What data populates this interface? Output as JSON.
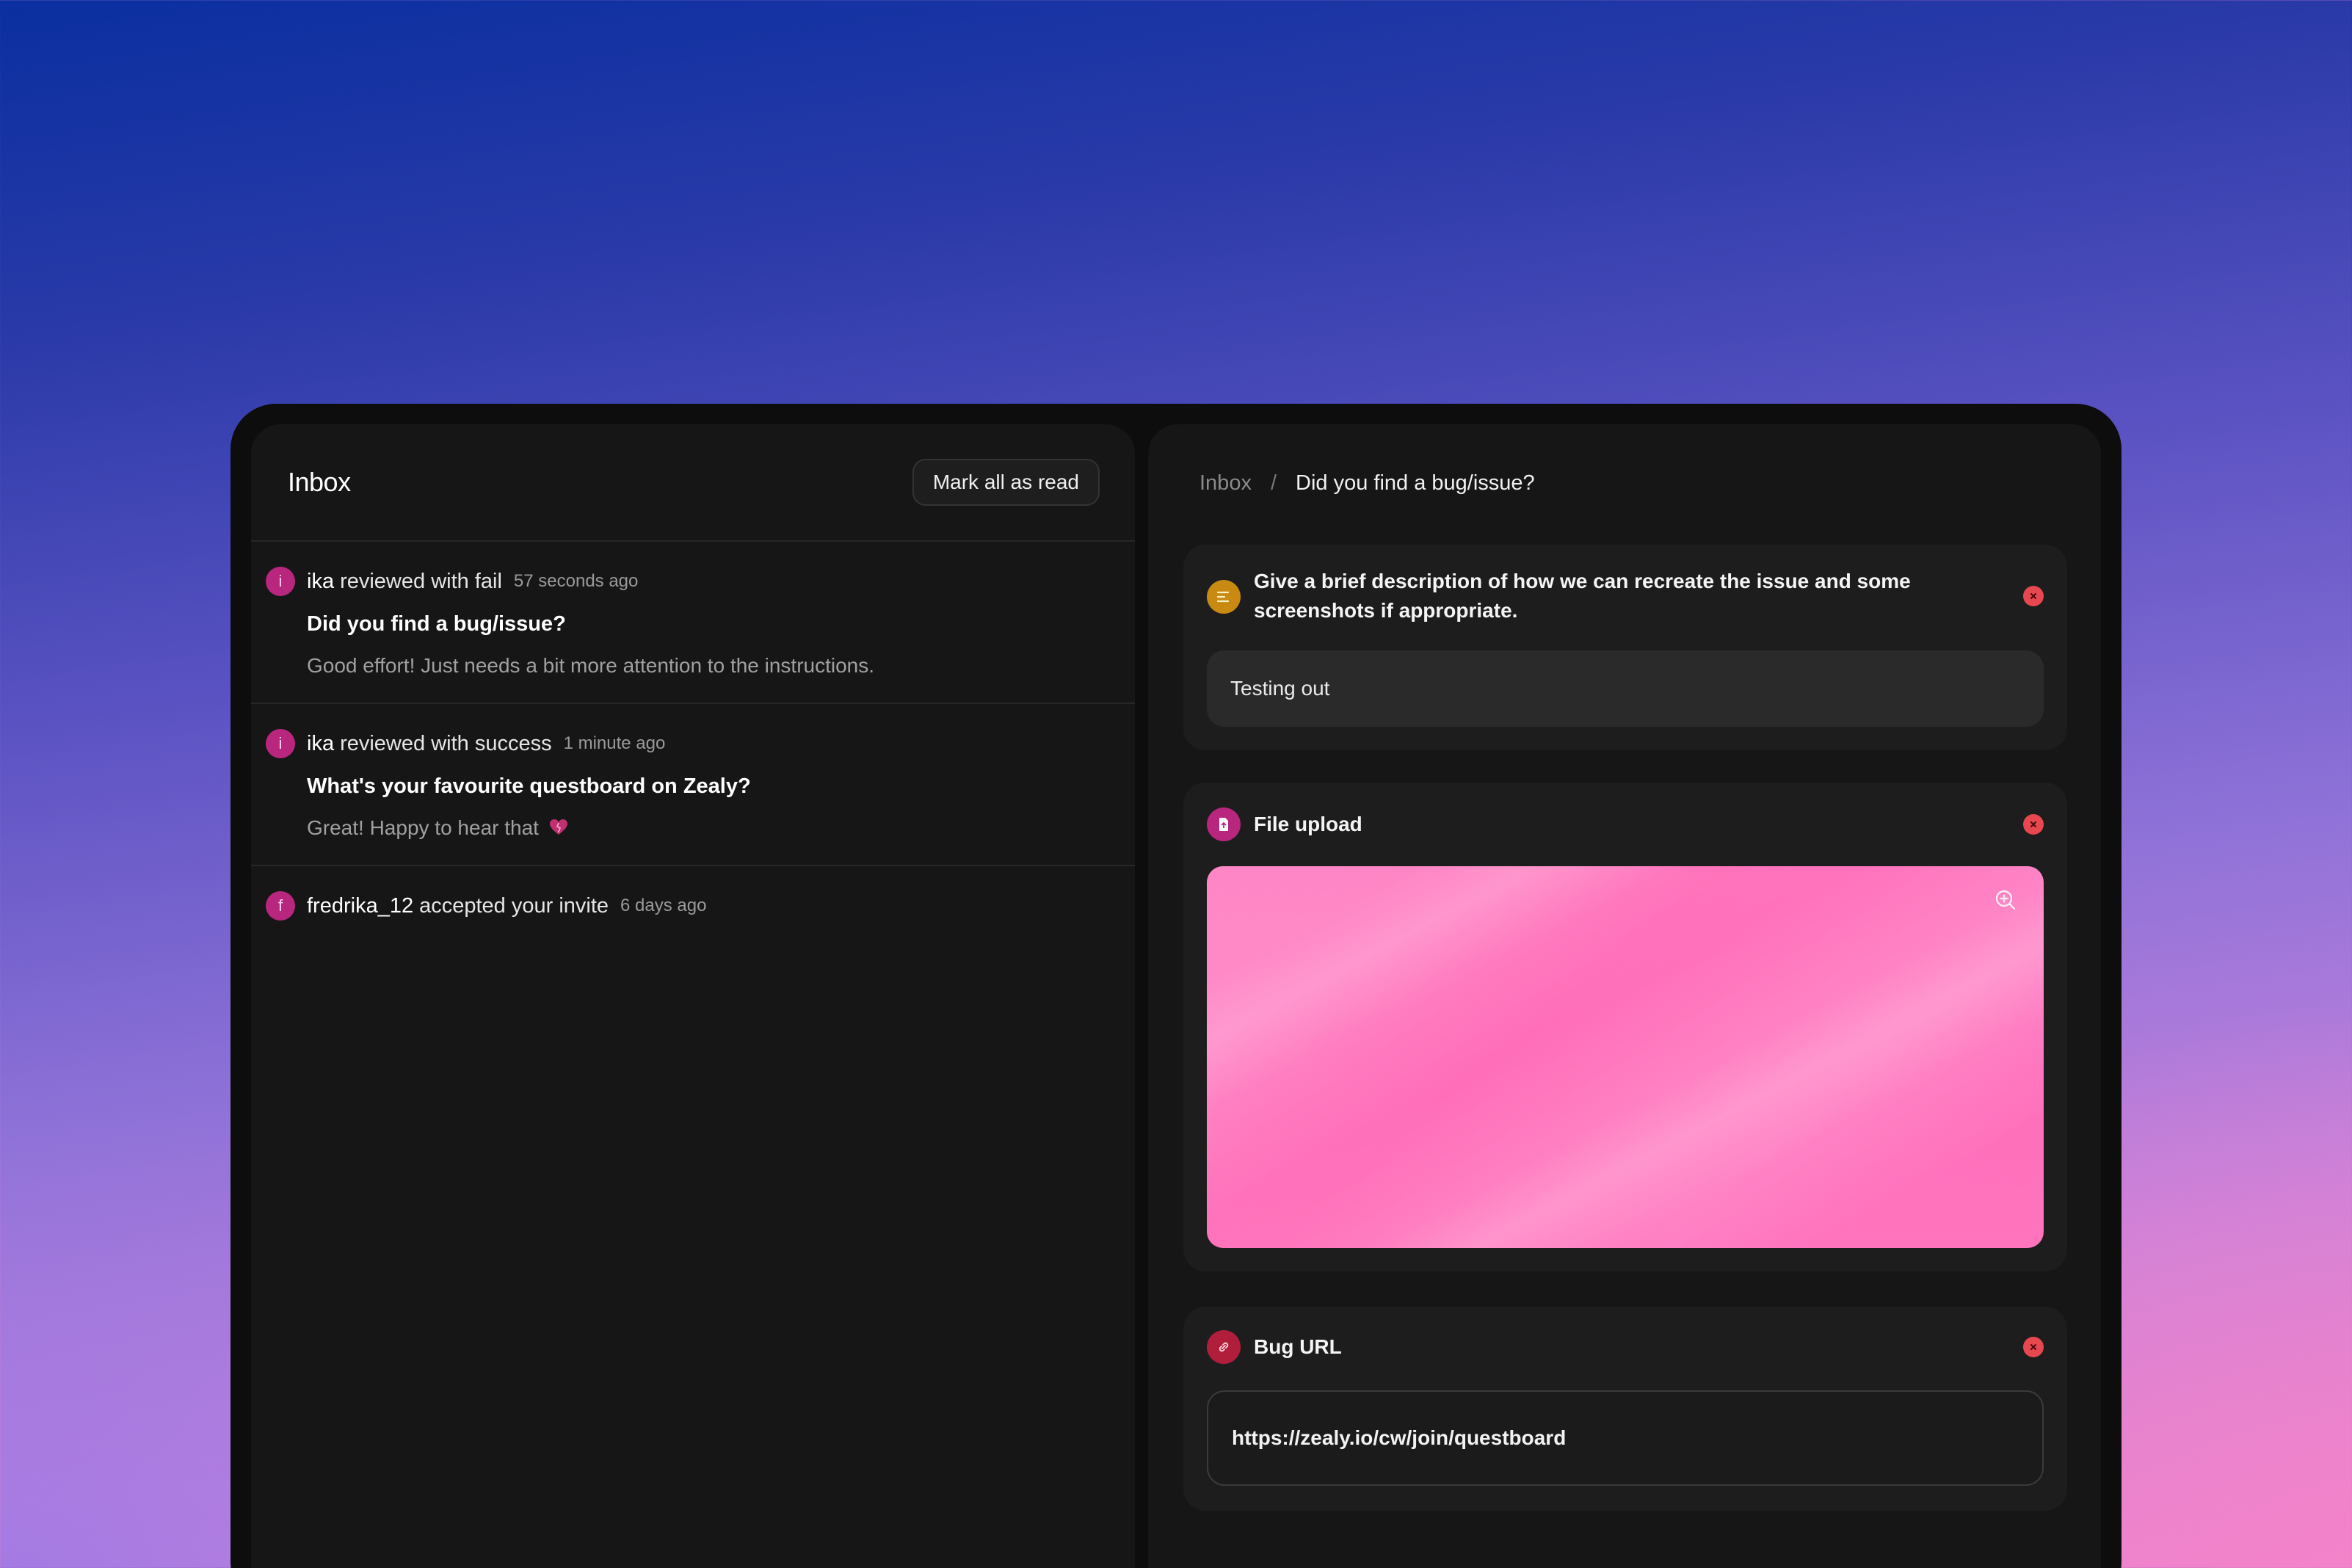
{
  "inbox": {
    "title": "Inbox",
    "mark_all_label": "Mark all as read",
    "notifications": [
      {
        "avatar_letter": "i",
        "user": "ika",
        "action": "reviewed with fail",
        "time": "57 seconds ago",
        "title": "Did you find a bug/issue?",
        "body": "Good effort! Just needs a bit more attention to the instructions."
      },
      {
        "avatar_letter": "i",
        "user": "ika",
        "action": "reviewed with success",
        "time": "1 minute ago",
        "title": "What's your favourite questboard on Zealy?",
        "body": "Great! Happy to hear that"
      },
      {
        "avatar_letter": "f",
        "user": "fredrika_12",
        "action": "accepted your invite",
        "time": "6 days ago"
      }
    ]
  },
  "detail": {
    "breadcrumb_root": "Inbox",
    "breadcrumb_separator": "/",
    "breadcrumb_current": "Did you find a bug/issue?",
    "description_card": {
      "title": "Give a brief description of how we can recreate the issue and some screenshots if appropriate.",
      "answer": "Testing out",
      "icon": "text-lines-icon",
      "icon_color": "#c98a12"
    },
    "upload_card": {
      "title": "File upload",
      "icon": "file-icon",
      "icon_color": "#b8267e"
    },
    "url_card": {
      "title": "Bug URL",
      "value": "https://zealy.io/cw/join/questboard",
      "icon": "link-icon",
      "icon_color": "#b01e3c"
    }
  },
  "colors": {
    "status_fail": "#e7474f",
    "accent_pink": "#ff6eb9",
    "panel_bg": "#161616"
  }
}
